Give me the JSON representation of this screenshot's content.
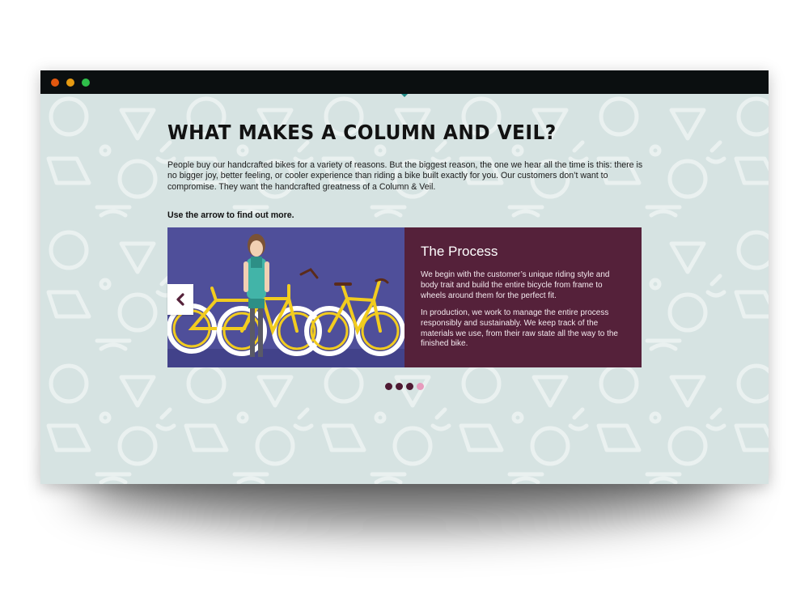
{
  "window": {
    "controls": [
      {
        "name": "close",
        "color": "#e2570f"
      },
      {
        "name": "minimize",
        "color": "#e69b12"
      },
      {
        "name": "maximize",
        "color": "#2fbf4a"
      }
    ]
  },
  "page": {
    "background_color": "#d6e3e2",
    "pattern_color": "#eef3f3",
    "heading": "WHAT MAKES A COLUMN AND VEIL?",
    "intro": "People buy our handcrafted bikes for a variety of reasons. But the biggest reason, the one we hear all the time is this: there is no bigger joy, better feeling, or cooler experience than riding a bike built exactly for you. Our customers don’t want to compromise. They want the handcrafted greatness of a Column & Veil.",
    "cta": "Use the arrow to find out more."
  },
  "slider": {
    "prev_icon": "chevron-left-icon",
    "illustration": "woman-with-yellow-bicycles",
    "title": "The Process",
    "paragraph_1": "We begin with the customer’s unique riding style and body trait and build the entire bicycle from frame to wheels around them for the perfect fit.",
    "paragraph_2": "In production, we work to manage the entire process responsibly and sustainably. We keep track of the materials we use, from their raw state all the way to the finished bike.",
    "panel_color": "#55213a",
    "illustration_bg": "#4f4f9a",
    "accent_color": "#f2cc1f",
    "pagination": {
      "total": 4,
      "active_index": 3,
      "dot_color": "#4f1a33",
      "active_color": "#e79bbd"
    }
  }
}
